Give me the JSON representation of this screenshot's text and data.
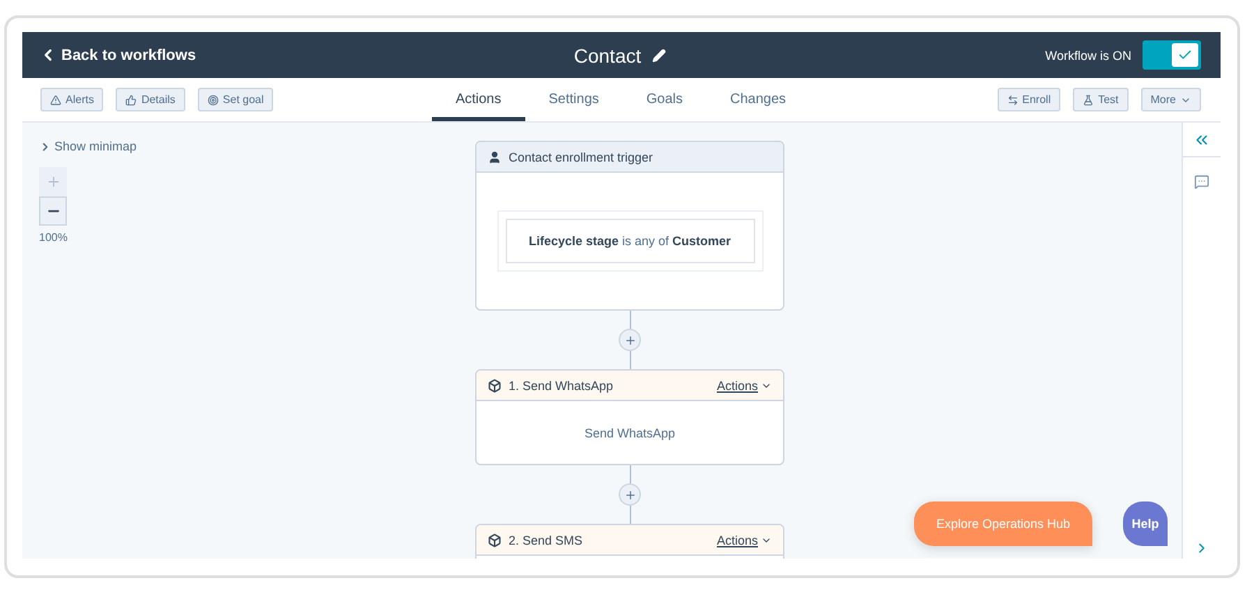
{
  "header": {
    "back_link": "Back to workflows",
    "title": "Contact",
    "toggle": {
      "label": "Workflow is ON",
      "on": true
    }
  },
  "toolbar": {
    "left_buttons": [
      {
        "label": "Alerts",
        "kind": "alert"
      },
      {
        "label": "Details",
        "kind": "details"
      },
      {
        "label": "Set goal",
        "kind": "goal"
      }
    ],
    "tabs": [
      {
        "label": "Actions",
        "selected": true
      },
      {
        "label": "Settings",
        "selected": false
      },
      {
        "label": "Goals",
        "selected": false
      },
      {
        "label": "Changes",
        "selected": false
      }
    ],
    "right_buttons": [
      {
        "label": "Enroll",
        "kind": "enroll"
      },
      {
        "label": "Test",
        "kind": "test"
      },
      {
        "label": "More",
        "kind": "menu"
      }
    ]
  },
  "canvas": {
    "minimap_toggle": "Show minimap",
    "zoom": {
      "zoom_in_disabled": true,
      "level_text": "100%"
    },
    "trigger": {
      "title": "Contact enrollment trigger",
      "condition": "**Lifecycle stage** is any of **Customer**"
    },
    "actions": [
      {
        "title": "1. Send WhatsApp",
        "menu": "Actions",
        "body": "Send WhatsApp"
      },
      {
        "title": "2. Send SMS",
        "menu": "Actions"
      }
    ]
  },
  "floating": {
    "explore_button": "Explore Operations Hub",
    "help_button": "Help"
  }
}
